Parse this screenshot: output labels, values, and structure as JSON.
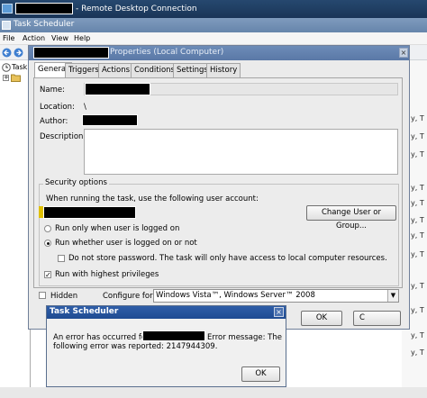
{
  "rdp": {
    "title": "- Remote Desktop Connection"
  },
  "app": {
    "title": "Task Scheduler"
  },
  "menu": {
    "file": "File",
    "action": "Action",
    "view": "View",
    "help": "Help"
  },
  "tree": {
    "root_label": "Task"
  },
  "properties": {
    "title_suffix": "Properties (Local Computer)",
    "tabs": [
      "General",
      "Triggers",
      "Actions",
      "Conditions",
      "Settings",
      "History"
    ],
    "name_label": "Name:",
    "location_label": "Location:",
    "location_value": "\\",
    "author_label": "Author:",
    "description_label": "Description:",
    "security_legend": "Security options",
    "user_account_prompt": "When running the task, use the following user account:",
    "change_user_button": "Change User or Group...",
    "radio_logged_on": "Run only when user is logged on",
    "radio_whether": "Run whether user is logged on or not",
    "no_store_password": "Do not store password.  The task will only have access to local computer resources.",
    "highest_privileges": "Run with highest privileges",
    "hidden_label": "Hidden",
    "configure_label": "Configure for:",
    "configure_value": "Windows Vista™, Windows Server™ 2008",
    "ok_button": "OK",
    "cancel_button": "C"
  },
  "error_dialog": {
    "title": "Task Scheduler",
    "message_prefix": "An error has occurred for task",
    "message_suffix": "Error message: The",
    "message_line2": "following error was reported: 2147944309.",
    "ok_button": "OK"
  },
  "background_right": [
    "y, T",
    "y, T",
    "y, T",
    "y, T",
    "y, T",
    "y, T",
    "y, T",
    "y, T",
    "y, T",
    "y, T",
    "y, T",
    "y, T"
  ]
}
